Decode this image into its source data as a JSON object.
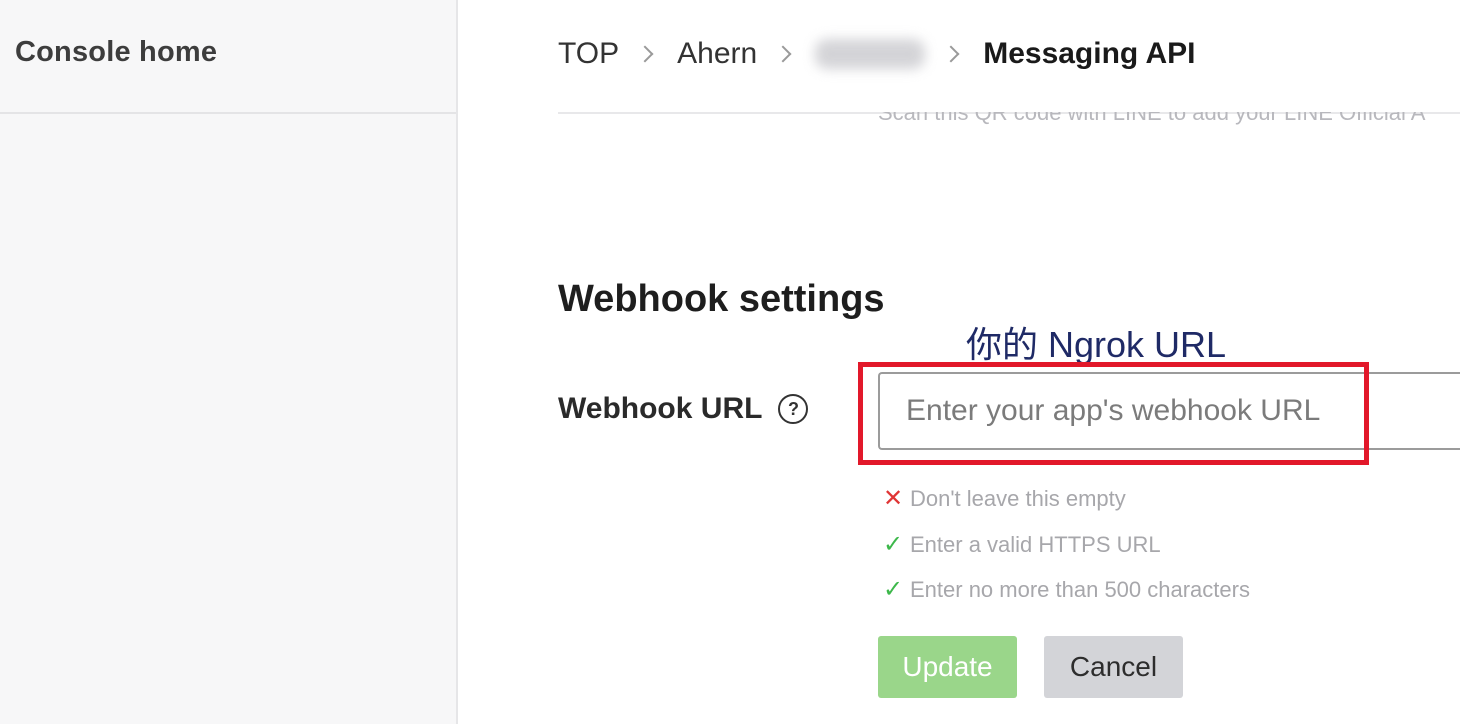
{
  "sidebar": {
    "title": "Console home"
  },
  "breadcrumb": {
    "items": [
      "TOP",
      "Ahern"
    ],
    "current": "Messaging API"
  },
  "partial_text": "Scan this QR code with LINE to add your LINE Official A",
  "webhook": {
    "section_title": "Webhook settings",
    "label": "Webhook URL",
    "help_icon": "?",
    "input_value": "",
    "input_placeholder": "Enter your app's webhook URL",
    "annotation": "你的 Ngrok URL",
    "rules": [
      {
        "status": "error",
        "icon": "✕",
        "text": "Don't leave this empty"
      },
      {
        "status": "ok",
        "icon": "✓",
        "text": "Enter a valid HTTPS URL"
      },
      {
        "status": "ok",
        "icon": "✓",
        "text": "Enter no more than 500 characters"
      }
    ],
    "update_label": "Update",
    "cancel_label": "Cancel"
  },
  "colors": {
    "highlight": "#e2182a",
    "update_button": "#9ad68a",
    "cancel_button": "#d3d4d8",
    "error": "#e03535",
    "ok": "#3db84b"
  }
}
